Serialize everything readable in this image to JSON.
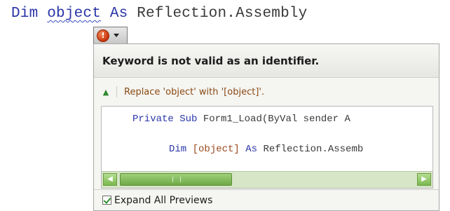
{
  "editor": {
    "code_line": {
      "dim": "Dim ",
      "identifier": "object",
      "as": " As ",
      "type": "Reflection.Assembly"
    }
  },
  "smart_tag": {
    "icon": "error-icon",
    "icon_glyph": "!",
    "arrow": "chevron-down-icon"
  },
  "popup": {
    "title": "Keyword is not valid as an identifier.",
    "fix_label": "Replace 'object' with '[object]'.",
    "fix_icon_glyph": "▲",
    "preview": {
      "line1_kw1": "Private Sub ",
      "line1_rest": "Form1_Load(ByVal sender A",
      "line2_kw": "Dim ",
      "line2_hl": "[object]",
      "line2_as": " As ",
      "line2_rest": "Reflection.Assemb"
    },
    "scroll_left_glyph": "◀",
    "scroll_right_glyph": "▶",
    "footer_label": "Expand All Previews"
  },
  "colors": {
    "keyword": "#2a35a8",
    "fix_text": "#8a4a12",
    "scrollbar": "#7ab84e"
  }
}
